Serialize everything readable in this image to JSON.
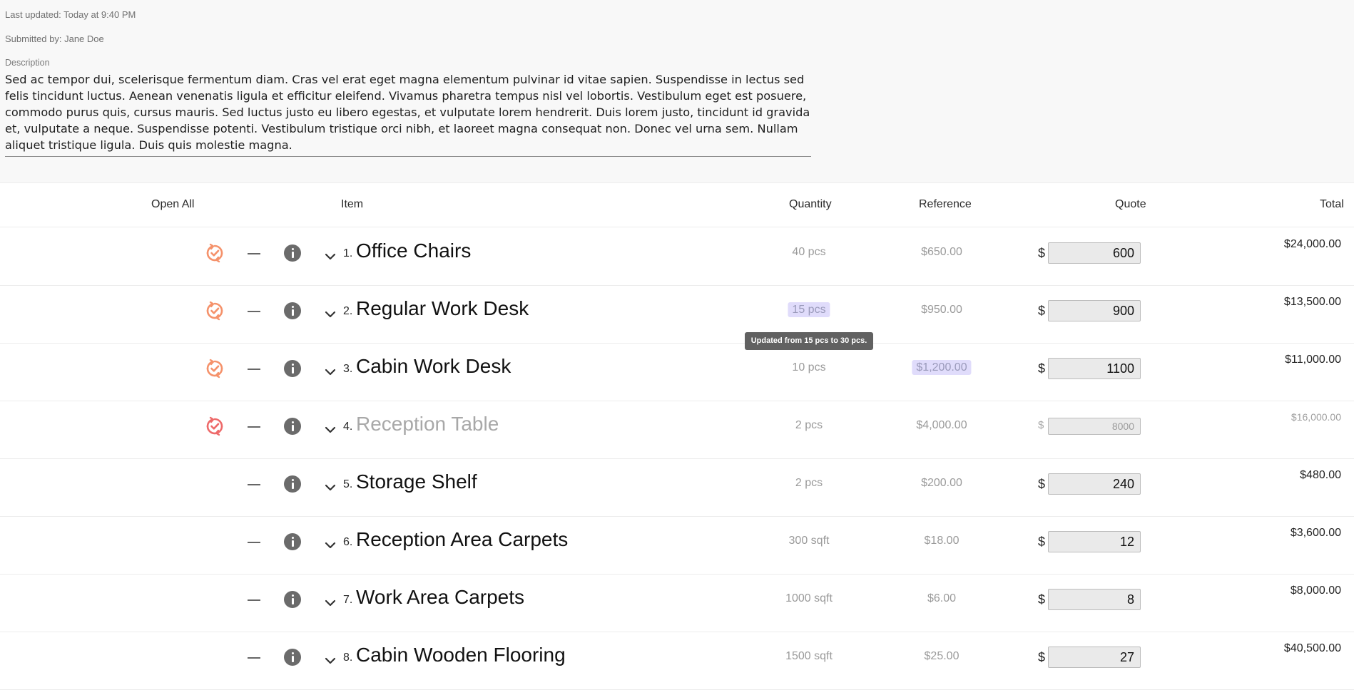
{
  "header": {
    "last_updated": "Last updated: Today at 9:40 PM",
    "submitted_by": "Submitted by: Jane Doe",
    "description_label": "Description",
    "description": "Sed ac tempor dui, scelerisque fermentum diam. Cras vel erat eget magna elementum pulvinar id vitae sapien. Suspendisse in lectus sed felis tincidunt luctus. Aenean venenatis ligula et efficitur eleifend. Vivamus pharetra tempus nisl vel lobortis. Vestibulum eget est posuere, commodo purus quis, cursus mauris.  Sed luctus justo eu libero egestas, et vulputate lorem hendrerit. Duis lorem justo, tincidunt id gravida et, vulputate a neque. Suspendisse potenti. Vestibulum tristique orci nibh, et laoreet magna consequat non. Donec vel urna sem. Nullam aliquet tristique ligula. Duis quis molestie magna."
  },
  "columns": {
    "open_all": "Open All",
    "item": "Item",
    "quantity": "Quantity",
    "reference": "Reference",
    "quote": "Quote",
    "total": "Total"
  },
  "colors": {
    "sync_icon": "#f5926b",
    "sync_icon_alert": "#ee6a6a",
    "highlight": "#e0dcfb"
  },
  "currency_symbol": "$",
  "tooltip": "Updated from 15 pcs to 30 pcs.",
  "rows": [
    {
      "num": "1.",
      "name": "Office Chairs",
      "qty": "40 pcs",
      "reference": "$650.00",
      "quote": "600",
      "total": "$24,000.00",
      "sync_icon": "sync-check-icon"
    },
    {
      "num": "2.",
      "name": "Regular Work Desk",
      "qty": "15 pcs",
      "reference": "$950.00",
      "quote": "900",
      "total": "$13,500.00",
      "sync_icon": "sync-check-icon",
      "qty_highlighted": true
    },
    {
      "num": "3.",
      "name": "Cabin Work Desk",
      "qty": "10 pcs",
      "reference": "$1,200.00",
      "quote": "1100",
      "total": "$11,000.00",
      "sync_icon": "sync-check-icon",
      "reference_highlighted": true
    },
    {
      "num": "4.",
      "name": "Reception Table",
      "qty": "2 pcs",
      "reference": "$4,000.00",
      "quote": "8000",
      "total": "$16,000.00",
      "sync_icon": "sync-check-icon",
      "disabled": true
    },
    {
      "num": "5.",
      "name": "Storage Shelf",
      "qty": "2 pcs",
      "reference": "$200.00",
      "quote": "240",
      "total": "$480.00"
    },
    {
      "num": "6.",
      "name": "Reception Area Carpets",
      "qty": "300 sqft",
      "reference": "$18.00",
      "quote": "12",
      "total": "$3,600.00"
    },
    {
      "num": "7.",
      "name": "Work Area Carpets",
      "qty": "1000 sqft",
      "reference": "$6.00",
      "quote": "8",
      "total": "$8,000.00"
    },
    {
      "num": "8.",
      "name": "Cabin Wooden Flooring",
      "qty": "1500 sqft",
      "reference": "$25.00",
      "quote": "27",
      "total": "$40,500.00"
    }
  ]
}
